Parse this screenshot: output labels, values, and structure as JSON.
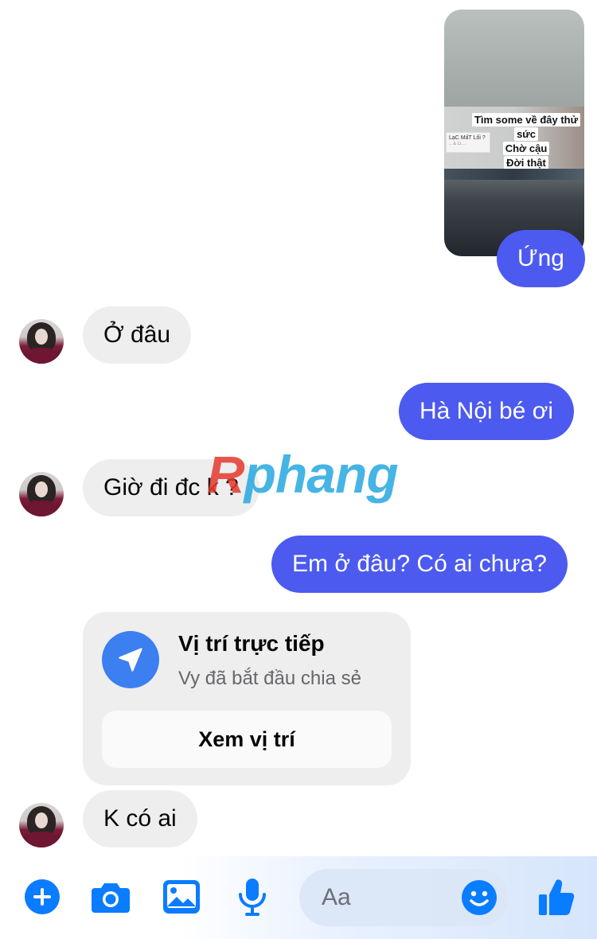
{
  "messages": {
    "sent_media": {
      "screen_text": "LạC MấT Lối ?",
      "screen_subtext": "... & 11 ...",
      "caption_lines": [
        "Tìm some về đây thử",
        "sức",
        "Chờ cậu",
        "Đời thật"
      ]
    },
    "reaction_reply": "Ứng",
    "incoming_1": "Ở đâu",
    "outgoing_1": "Hà Nội bé ơi",
    "incoming_2": "Giờ đi đc k ?",
    "outgoing_2": "Em ở đâu? Có ai chưa?",
    "location": {
      "title": "Vị trí trực tiếp",
      "subtitle": "Vy đã bắt đầu chia sẻ",
      "button": "Xem vị trí"
    },
    "incoming_3": "K có ai"
  },
  "watermark": {
    "r": "R",
    "rest": "phang"
  },
  "composer": {
    "placeholder": "Aa",
    "icons": [
      "plus-icon",
      "camera-icon",
      "image-icon",
      "microphone-icon",
      "emoji-icon",
      "like-icon"
    ]
  },
  "colors": {
    "outgoing_bubble": "#4c5af0",
    "incoming_bubble": "#eeeeee",
    "accent": "#0a7cff",
    "location_icon": "#3b7ff0"
  }
}
